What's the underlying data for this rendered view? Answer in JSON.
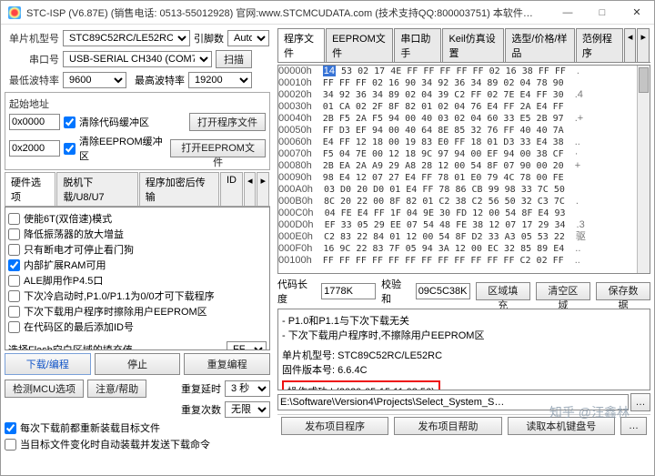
{
  "title": "STC-ISP (V6.87E) (销售电话: 0513-55012928) 官网:www.STCMCUDATA.com (技术支持QQ:800003751) 本软件…",
  "left": {
    "mcu_label": "单片机型号",
    "mcu_value": "STC89C52RC/LE52RC",
    "pins_label": "引脚数",
    "pins_value": "Auto",
    "port_label": "串口号",
    "port_value": "USB-SERIAL CH340 (COM7)",
    "scan_btn": "扫描",
    "baud_lo_label": "最低波特率",
    "baud_lo_value": "9600",
    "baud_hi_label": "最高波特率",
    "baud_hi_value": "19200",
    "start_addr_title": "起始地址",
    "addr1": "0x0000",
    "chk_clear_code": "清除代码缓冲区",
    "open_code_btn": "打开程序文件",
    "addr2": "0x2000",
    "chk_clear_eeprom": "清除EEPROM缓冲区",
    "open_eeprom_btn": "打开EEPROM文件",
    "hw_tabs": [
      "硬件选项",
      "脱机下载/U8/U7",
      "程序加密后传输",
      "ID"
    ],
    "opt1": "使能6T(双倍速)模式",
    "opt2": "降低振荡器的放大增益",
    "opt3": "只有断电才可停止看门狗",
    "opt4": "内部扩展RAM可用",
    "opt5": "ALE脚用作P4.5口",
    "opt6": "下次冷启动时,P1.0/P1.1为0/0才可下载程序",
    "opt7": "下次下载用户程序时擦除用户EEPROM区",
    "opt8": "在代码区的最后添加ID号",
    "fill_label": "选择Flash空白区域的填充值",
    "fill_value": "FF",
    "dl_btn": "下载/编程",
    "stop_btn": "停止",
    "reprog_btn": "重复编程",
    "detect_btn": "检测MCU选项",
    "help_btn": "注意/帮助",
    "delay_label": "重复延时",
    "delay_value": "3 秒",
    "count_label": "重复次数",
    "count_value": "无限",
    "auto_reload": "每次下载前都重新装载目标文件",
    "auto_send": "当目标文件变化时自动装载并发送下载命令"
  },
  "right": {
    "tabs": [
      "程序文件",
      "EEPROM文件",
      "串口助手",
      "Keil仿真设置",
      "选型/价格/样品",
      "范例程序"
    ],
    "hex_rows": [
      {
        "a": "00000h",
        "d": "14 53 02 17 4E FF FF FF FF FF 02 16 38 FF FF",
        "s": "."
      },
      {
        "a": "00010h",
        "d": "FF FF FF 02 16 90 34 92 36 34 89 02 04 78 90",
        "s": ""
      },
      {
        "a": "00020h",
        "d": "34 92 36 34 89 02 04 39 C2 FF 02 7E E4 FF 30",
        "s": ".4"
      },
      {
        "a": "00030h",
        "d": "01 CA 02 2F 8F 82 01 02 04 76 E4 FF 2A E4 FF",
        "s": ""
      },
      {
        "a": "00040h",
        "d": "2B F5 2A F5 94 00 40 03 02 04 60 33 E5 2B 97",
        "s": ".+"
      },
      {
        "a": "00050h",
        "d": "FF D3 EF 94 00 40 64 8E 85 32 76 FF 40 40 7A",
        "s": ""
      },
      {
        "a": "00060h",
        "d": "E4 FF 12 18 00 19 83 E0 FF 18 01 D3 33 E4 38",
        "s": ".."
      },
      {
        "a": "00070h",
        "d": "F5 04 7E 00 12 18 9C 97 94 00 EF 94 00 38 CF",
        "s": "·"
      },
      {
        "a": "00080h",
        "d": "2B EA 2A A9 29 A8 28 12 00 54 8F 07 90 00 20",
        "s": "+"
      },
      {
        "a": "00090h",
        "d": "98 E4 12 07 27 E4 FF 78 01 E0 79 4C 78 00 FE",
        "s": ""
      },
      {
        "a": "000A0h",
        "d": "03 D0 20 D0 01 E4 FF 78 86 CB 99 98 33 7C 50",
        "s": ""
      },
      {
        "a": "000B0h",
        "d": "8C 20 22 00 8F 82 01 C2 38 C2 56 50 32 C3 7C",
        "s": "."
      },
      {
        "a": "000C0h",
        "d": "04 FE E4 FF 1F 04 9E 30 FD 12 00 54 8F E4 93",
        "s": ""
      },
      {
        "a": "000D0h",
        "d": "EF 33 05 29 EE 07 54 48 FE 38 12 07 17 29 34",
        "s": ".3"
      },
      {
        "a": "000E0h",
        "d": "C2 83 22 84 01 12 00 54 8F D2 33 A3 05 53 22",
        "s": "驱"
      },
      {
        "a": "000F0h",
        "d": "16 9C 22 83 7F 05 94 3A 12 00 EC 32 85 89 E4",
        "s": ".."
      },
      {
        "a": "00100h",
        "d": "FF FF FF FF FF FF FF FF FF FF FF FF C2 02 FF",
        "s": ".."
      }
    ],
    "code_len_label": "代码长度",
    "code_len_value": "1778K",
    "checksum_label": "校验和",
    "checksum_value": "09C5C38K",
    "fill_area_btn": "区域填充",
    "clear_area_btn": "清空区域",
    "save_data_btn": "保存数据",
    "log_l1": "- P1.0和P1.1与下次下载无关",
    "log_l2": "- 下次下载用户程序时,不擦除用户EEPROM区",
    "log_l3": "单片机型号: STC89C52RC/LE52RC",
    "log_l4": "固件版本号: 6.6.4C",
    "log_success": "操作成功 ! (2020-05-15 11:08:56)",
    "path_value": "E:\\Software\\Version4\\Projects\\Select_System_S…",
    "bottom_btns": [
      "发布项目程序",
      "发布项目帮助",
      "读取本机键盘号",
      "…"
    ]
  },
  "watermark": "知乎 @汪鑫林"
}
